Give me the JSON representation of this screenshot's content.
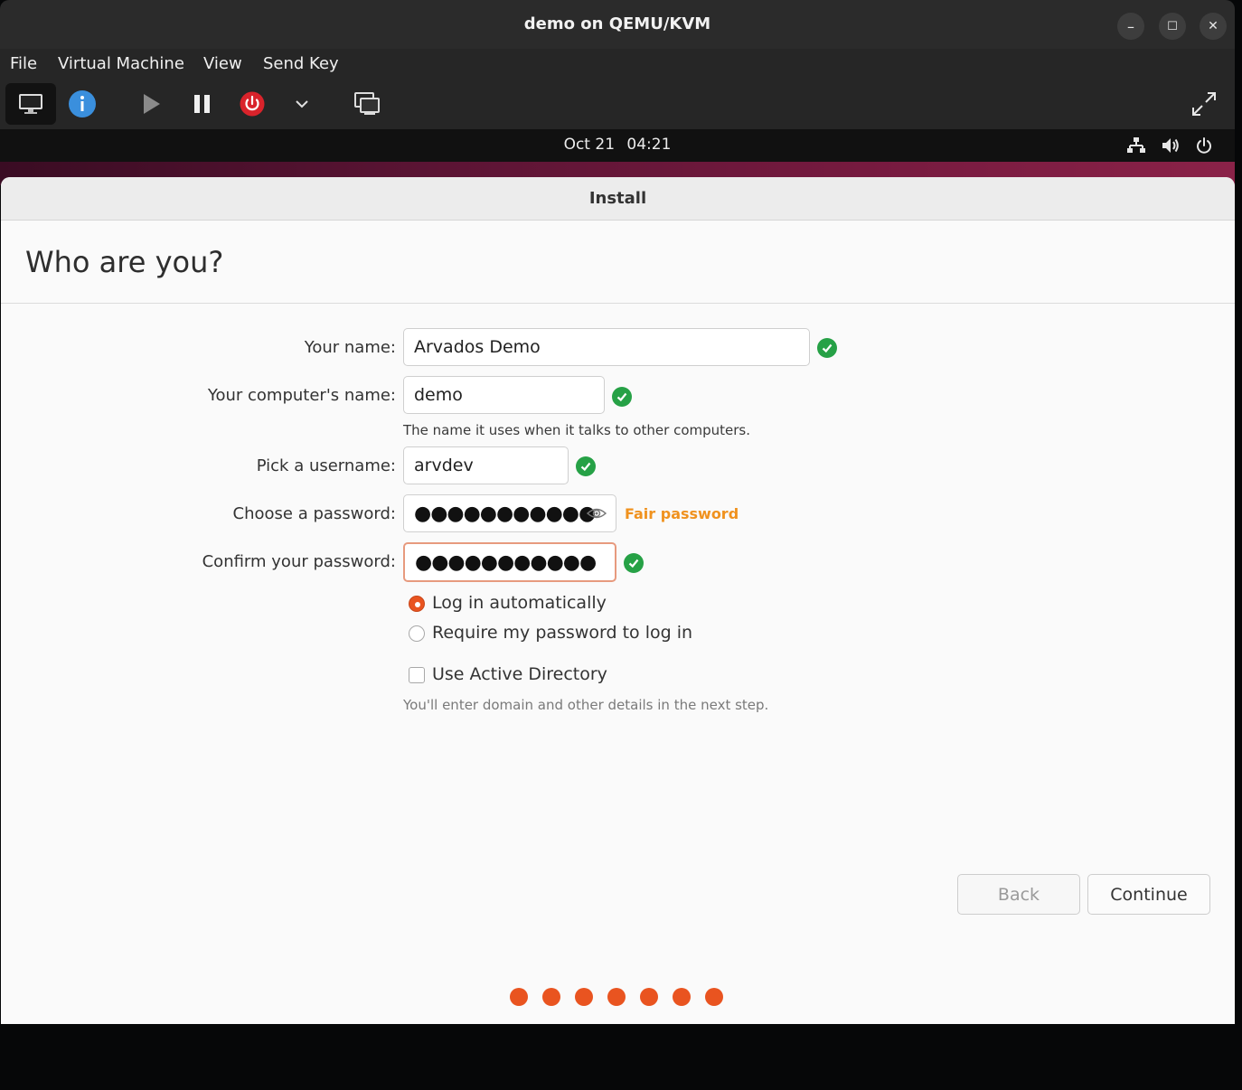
{
  "window": {
    "title": "demo on QEMU/KVM",
    "minimize_glyph": "–",
    "maximize_glyph": "☐",
    "close_glyph": "✕"
  },
  "menu": {
    "items": [
      "File",
      "Virtual Machine",
      "View",
      "Send Key"
    ]
  },
  "toolbar": {
    "icons": [
      "monitor-icon",
      "info-icon",
      "play-icon",
      "pause-icon",
      "power-icon",
      "chevron-down-icon",
      "screenshot-icon",
      "fullscreen-icon"
    ]
  },
  "guest_topbar": {
    "date": "Oct 21",
    "time": "04:21",
    "icons": [
      "network-icon",
      "volume-icon",
      "power-icon"
    ]
  },
  "installer": {
    "header_title": "Install",
    "page_title": "Who are you?",
    "fields": {
      "name": {
        "label": "Your name:",
        "value": "Arvados Demo",
        "valid": true
      },
      "computer": {
        "label": "Your computer's name:",
        "value": "demo",
        "hint": "The name it uses when it talks to other computers.",
        "valid": true
      },
      "username": {
        "label": "Pick a username:",
        "value": "arvdev",
        "valid": true
      },
      "password": {
        "label": "Choose a password:",
        "masked": "●●●●●●●●●●●",
        "strength": "Fair password"
      },
      "confirm": {
        "label": "Confirm your password:",
        "masked": "●●●●●●●●●●●",
        "valid": true
      }
    },
    "login_options": {
      "auto": "Log in automatically",
      "require": "Require my password to log in",
      "selected": "auto"
    },
    "active_directory": {
      "label": "Use Active Directory",
      "checked": false,
      "hint": "You'll enter domain and other details in the next step."
    },
    "buttons": {
      "back": "Back",
      "continue": "Continue"
    },
    "progress": {
      "total": 7,
      "completed": 7
    }
  },
  "colors": {
    "accent": "#e95420",
    "valid": "#26a146",
    "warning": "#f0921e"
  }
}
